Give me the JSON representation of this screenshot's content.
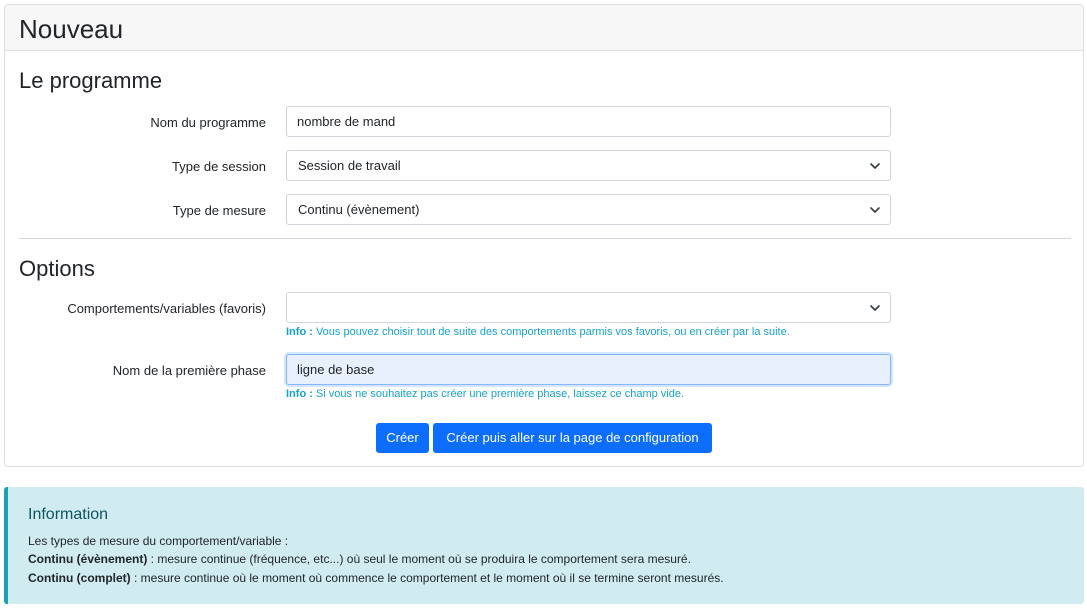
{
  "card": {
    "title": "Nouveau",
    "program_section": {
      "title": "Le programme",
      "name_label": "Nom du programme",
      "name_value": "nombre de mand",
      "session_label": "Type de session",
      "session_value": "Session de travail",
      "measure_label": "Type de mesure",
      "measure_value": "Continu (évènement)"
    },
    "options_section": {
      "title": "Options",
      "behaviors_label": "Comportements/variables (favoris)",
      "behaviors_value": "",
      "behaviors_help_prefix": "Info :",
      "behaviors_help_text": " Vous pouvez choisir tout de suite des comportements parmis vos favoris, ou en créer par la suite.",
      "phase_label": "Nom de la première phase",
      "phase_value": "ligne de base",
      "phase_help_prefix": "Info :",
      "phase_help_text": " Si vous ne souhaitez pas créer une première phase, laissez ce champ vide."
    },
    "buttons": {
      "create": "Créer",
      "create_and_configure": "Créer puis aller sur la page de configuration"
    }
  },
  "info": {
    "title": "Information",
    "intro": "Les types de mesure du comportement/variable :",
    "item1_term": "Continu (évènement)",
    "item1_text": " : mesure continue (fréquence, etc...) où seul le moment où se produira le comportement sera mesuré.",
    "item2_term": "Continu (complet)",
    "item2_text": " : mesure continue où le moment où commence le comportement et le moment où il se termine seront mesurés."
  },
  "colors": {
    "primary": "#0d6efd",
    "info_text": "#17a2c8",
    "info_bg": "#d1ecf1",
    "info_border": "#17a2b8"
  },
  "icons": {
    "select_arrow": "chevron-down-icon"
  }
}
